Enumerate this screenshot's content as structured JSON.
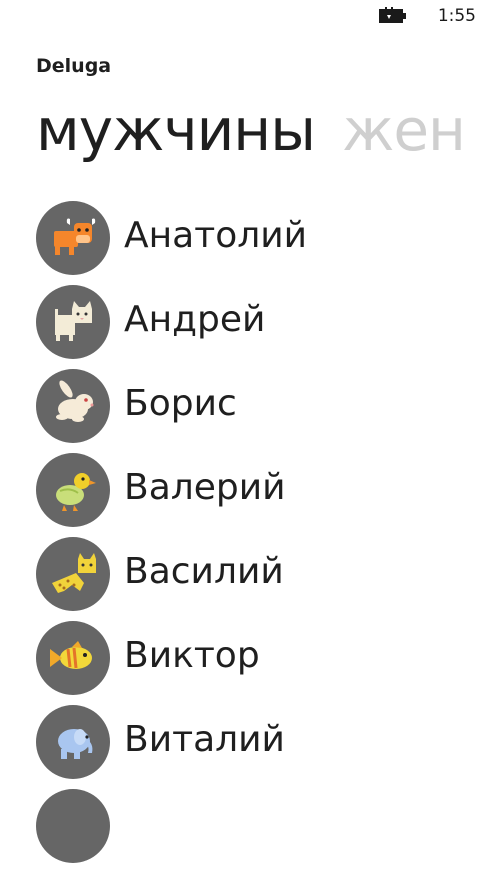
{
  "status_bar": {
    "time": "1:55",
    "battery_icon": "battery-charging-icon"
  },
  "app": {
    "title": "Deluga"
  },
  "pivot": {
    "tabs": [
      {
        "label": "мужчины",
        "active": true
      },
      {
        "label": "жен",
        "active": false
      }
    ]
  },
  "list": {
    "items": [
      {
        "name": "Анатолий",
        "icon": "bull-icon"
      },
      {
        "name": "Андрей",
        "icon": "cat-icon"
      },
      {
        "name": "Борис",
        "icon": "rabbit-icon"
      },
      {
        "name": "Валерий",
        "icon": "duckling-icon"
      },
      {
        "name": "Василий",
        "icon": "leopard-icon"
      },
      {
        "name": "Виктор",
        "icon": "fish-icon"
      },
      {
        "name": "Виталий",
        "icon": "elephant-icon"
      },
      {
        "name": "",
        "icon": "avatar-icon"
      }
    ]
  },
  "colors": {
    "avatar_bg": "#666666",
    "text": "#1f1f1f",
    "inactive_tab": "#cfcfcf"
  }
}
